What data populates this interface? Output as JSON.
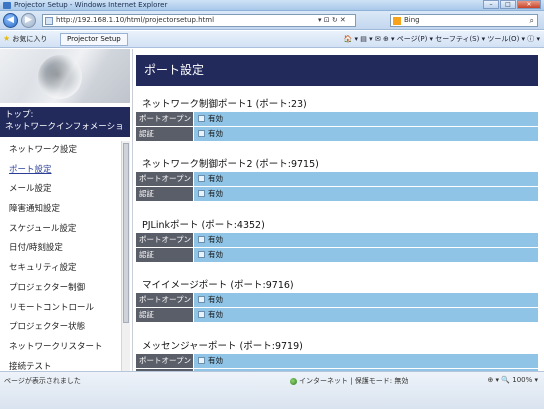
{
  "window": {
    "title": "Projector Setup - Windows Internet Explorer",
    "min": "–",
    "max": "□",
    "close": "✕"
  },
  "browser": {
    "back": "◀",
    "forward": "▶",
    "url": "http://192.168.1.10/html/projectorsetup.html",
    "addr_tools": "▾  ⊡  ↻  ✕",
    "search_label": "Bing",
    "search_icon": "⌕",
    "favorites": "お気に入り",
    "tab_label": "Projector Setup",
    "commands": "🏠 ▾  ▤ ▾  ✉  ⊕ ▾  ページ(P) ▾  セーフティ(S) ▾  ツール(O) ▾  ⓘ ▾"
  },
  "sidebar": {
    "top_line1": "トップ:",
    "top_line2": "ネットワークインフォメーション",
    "items": [
      {
        "label": "ネットワーク設定"
      },
      {
        "label": "ポート設定"
      },
      {
        "label": "メール設定"
      },
      {
        "label": "障害通知設定"
      },
      {
        "label": "スケジュール設定"
      },
      {
        "label": "日付/時刻設定"
      },
      {
        "label": "セキュリティ設定"
      },
      {
        "label": "プロジェクター制御"
      },
      {
        "label": "リモートコントロール"
      },
      {
        "label": "プロジェクター状態"
      },
      {
        "label": "ネットワークリスタート"
      },
      {
        "label": "接続テスト"
      }
    ]
  },
  "main": {
    "heading": "ポート設定",
    "sections": [
      {
        "title": "ネットワーク制御ポート1 (ポート:23)",
        "rows": [
          {
            "label": "ポートオープン",
            "value": "有効"
          },
          {
            "label": "認証",
            "value": "有効"
          }
        ]
      },
      {
        "title": "ネットワーク制御ポート2 (ポート:9715)",
        "rows": [
          {
            "label": "ポートオープン",
            "value": "有効"
          },
          {
            "label": "認証",
            "value": "有効"
          }
        ]
      },
      {
        "title": "PJLinkポート (ポート:4352)",
        "rows": [
          {
            "label": "ポートオープン",
            "value": "有効"
          },
          {
            "label": "認証",
            "value": "有効"
          }
        ]
      },
      {
        "title": "マイイメージポート (ポート:9716)",
        "rows": [
          {
            "label": "ポートオープン",
            "value": "有効"
          },
          {
            "label": "認証",
            "value": "有効"
          }
        ]
      },
      {
        "title": "メッセンジャーポート (ポート:9719)",
        "rows": [
          {
            "label": "ポートオープン",
            "value": "有効"
          },
          {
            "label": "認証",
            "value": "有効"
          }
        ]
      }
    ]
  },
  "status": {
    "left": "ページが表示されました",
    "mid": "インターネット | 保護モード: 無効",
    "right": "⊕ ▾  🔍 100% ▾"
  }
}
